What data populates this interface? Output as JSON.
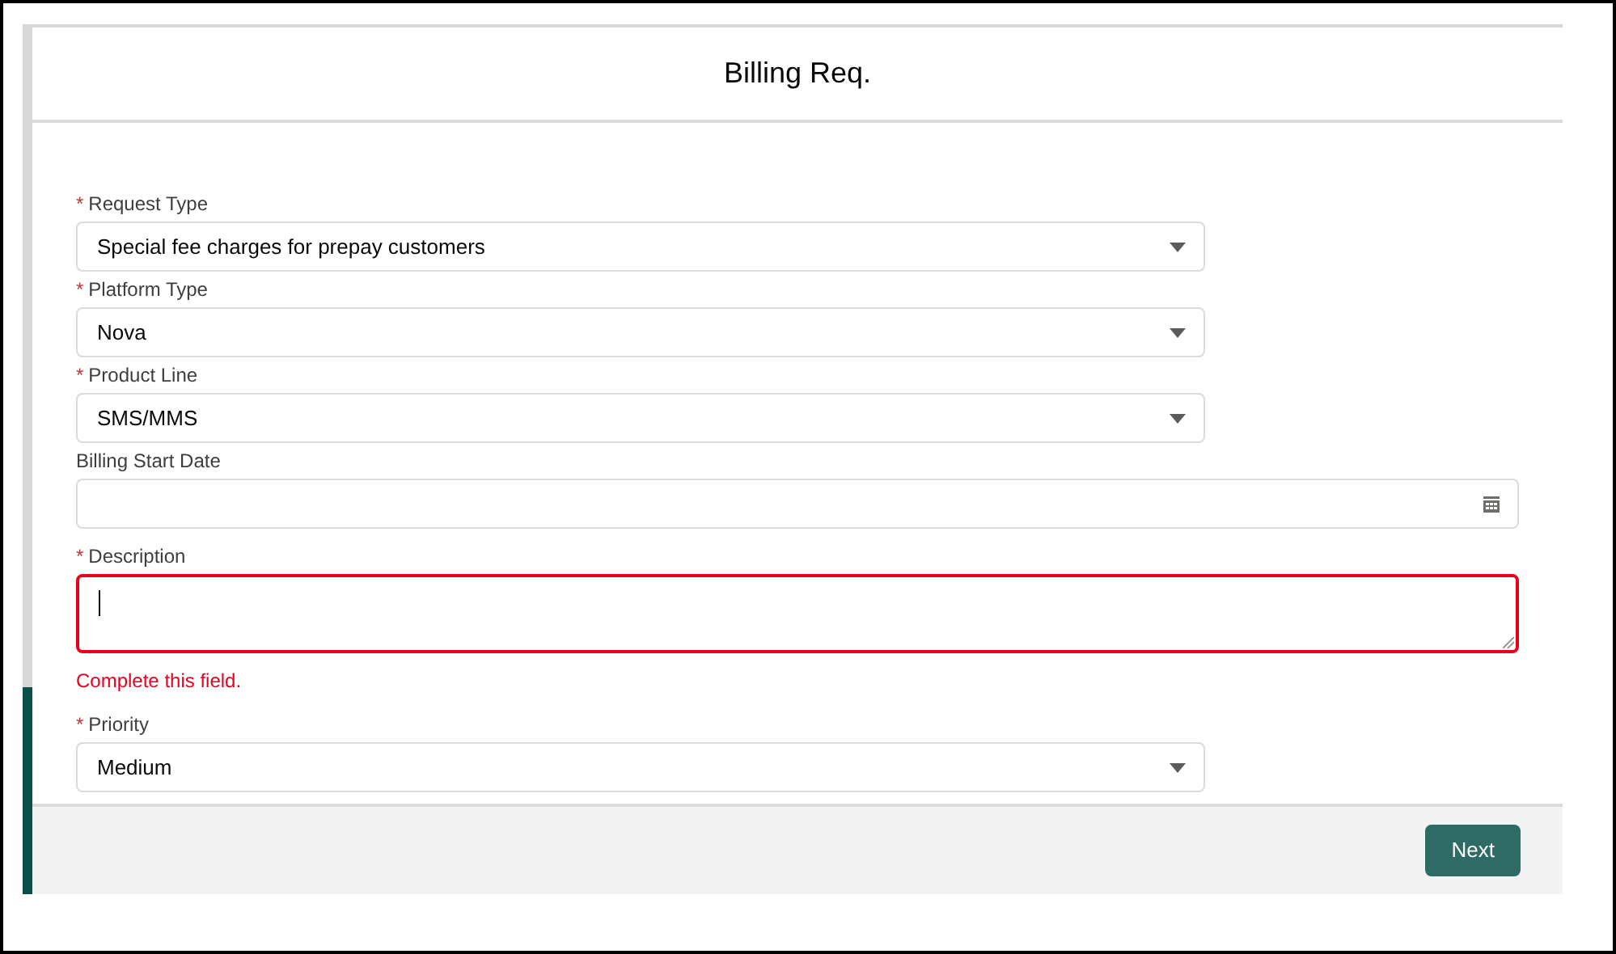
{
  "modal": {
    "title": "Billing Req."
  },
  "fields": [
    {
      "kind": "select",
      "required_mark": "*",
      "label": "Request Type",
      "value": "Special fee charges for prepay customers"
    },
    {
      "kind": "select",
      "required_mark": "*",
      "label": "Platform Type",
      "value": "Nova"
    },
    {
      "kind": "select",
      "required_mark": "*",
      "label": "Product Line",
      "value": "SMS/MMS"
    },
    {
      "kind": "date",
      "label": "Billing Start Date"
    },
    {
      "kind": "textarea",
      "required_mark": "*",
      "label": "Description",
      "error": "Complete this field."
    },
    {
      "kind": "select",
      "required_mark": "*",
      "label": "Priority",
      "value": "Medium"
    }
  ],
  "footer": {
    "button": "Next"
  }
}
